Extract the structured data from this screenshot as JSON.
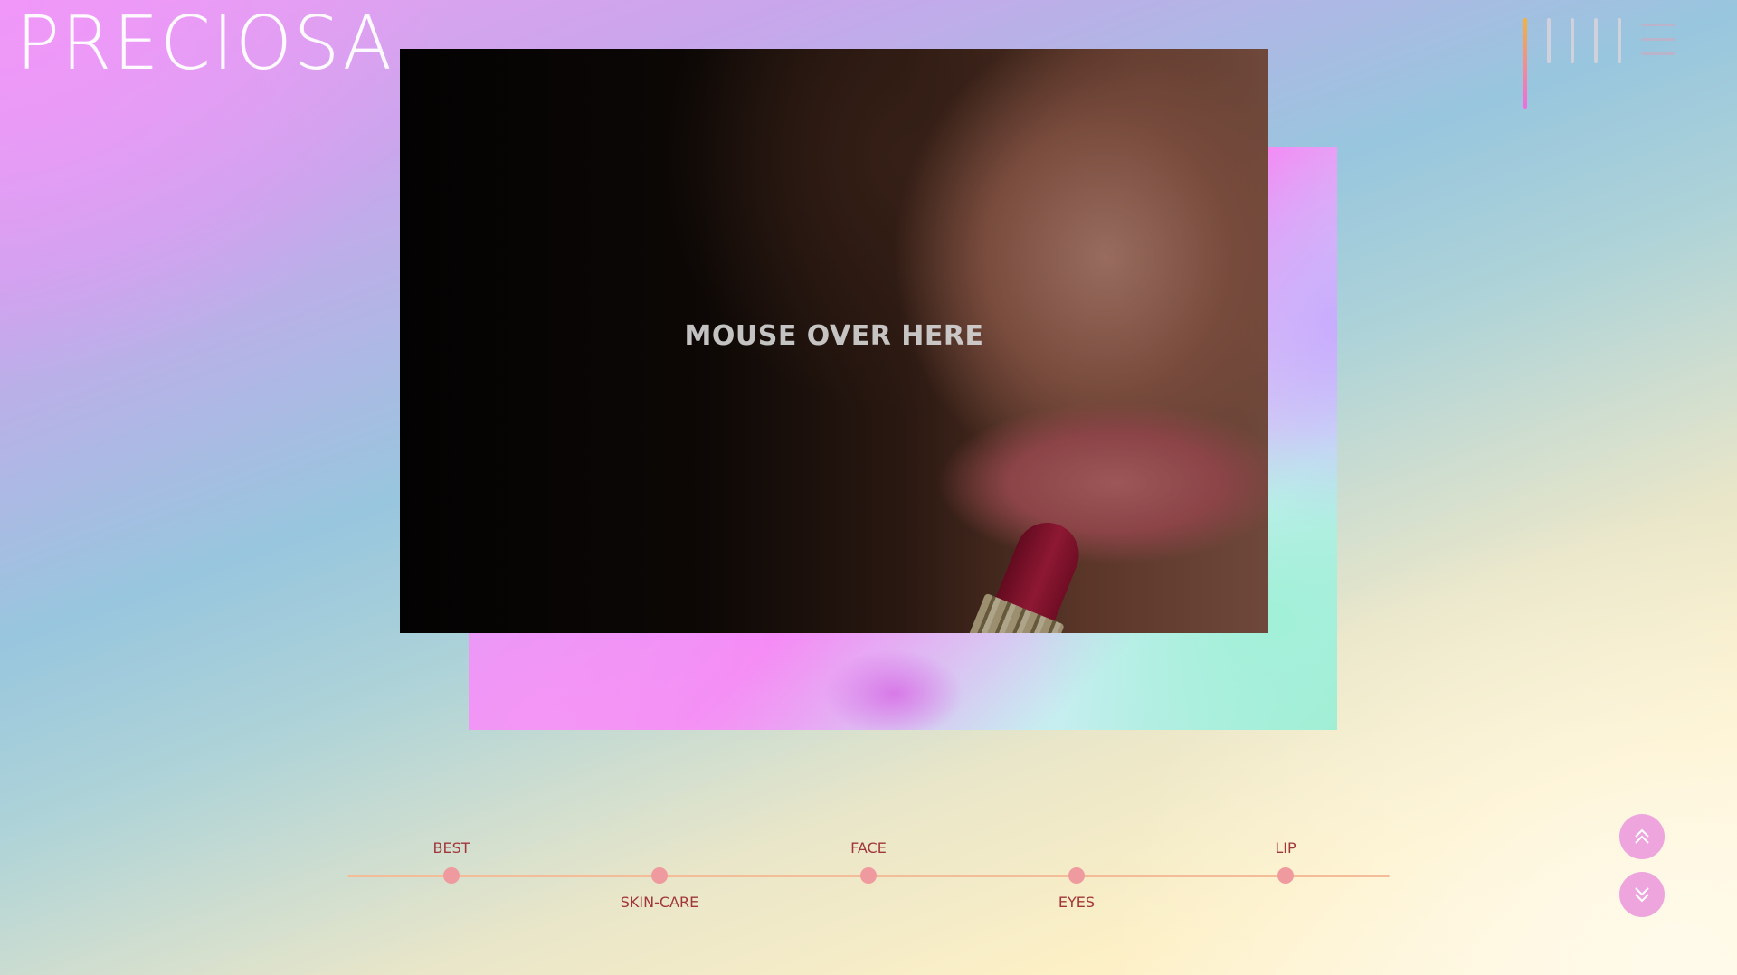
{
  "brand": {
    "logo_text": "PRECIOSA"
  },
  "hero": {
    "cta_text": "MOUSE OVER HERE"
  },
  "timeline": {
    "items": [
      {
        "label": "BEST",
        "position": "top"
      },
      {
        "label": "SKIN-CARE",
        "position": "bottom"
      },
      {
        "label": "FACE",
        "position": "top"
      },
      {
        "label": "EYES",
        "position": "bottom"
      },
      {
        "label": "LIP",
        "position": "top"
      }
    ]
  },
  "icons": {
    "menu": "hamburger-menu-icon",
    "scroll_up": "double-chevron-up-icon",
    "scroll_down": "double-chevron-down-icon"
  },
  "colors": {
    "accent_pink": "#ef9a9e",
    "label_red": "#a1363a",
    "track": "#f3bd9a",
    "button": "#eb96dc"
  }
}
